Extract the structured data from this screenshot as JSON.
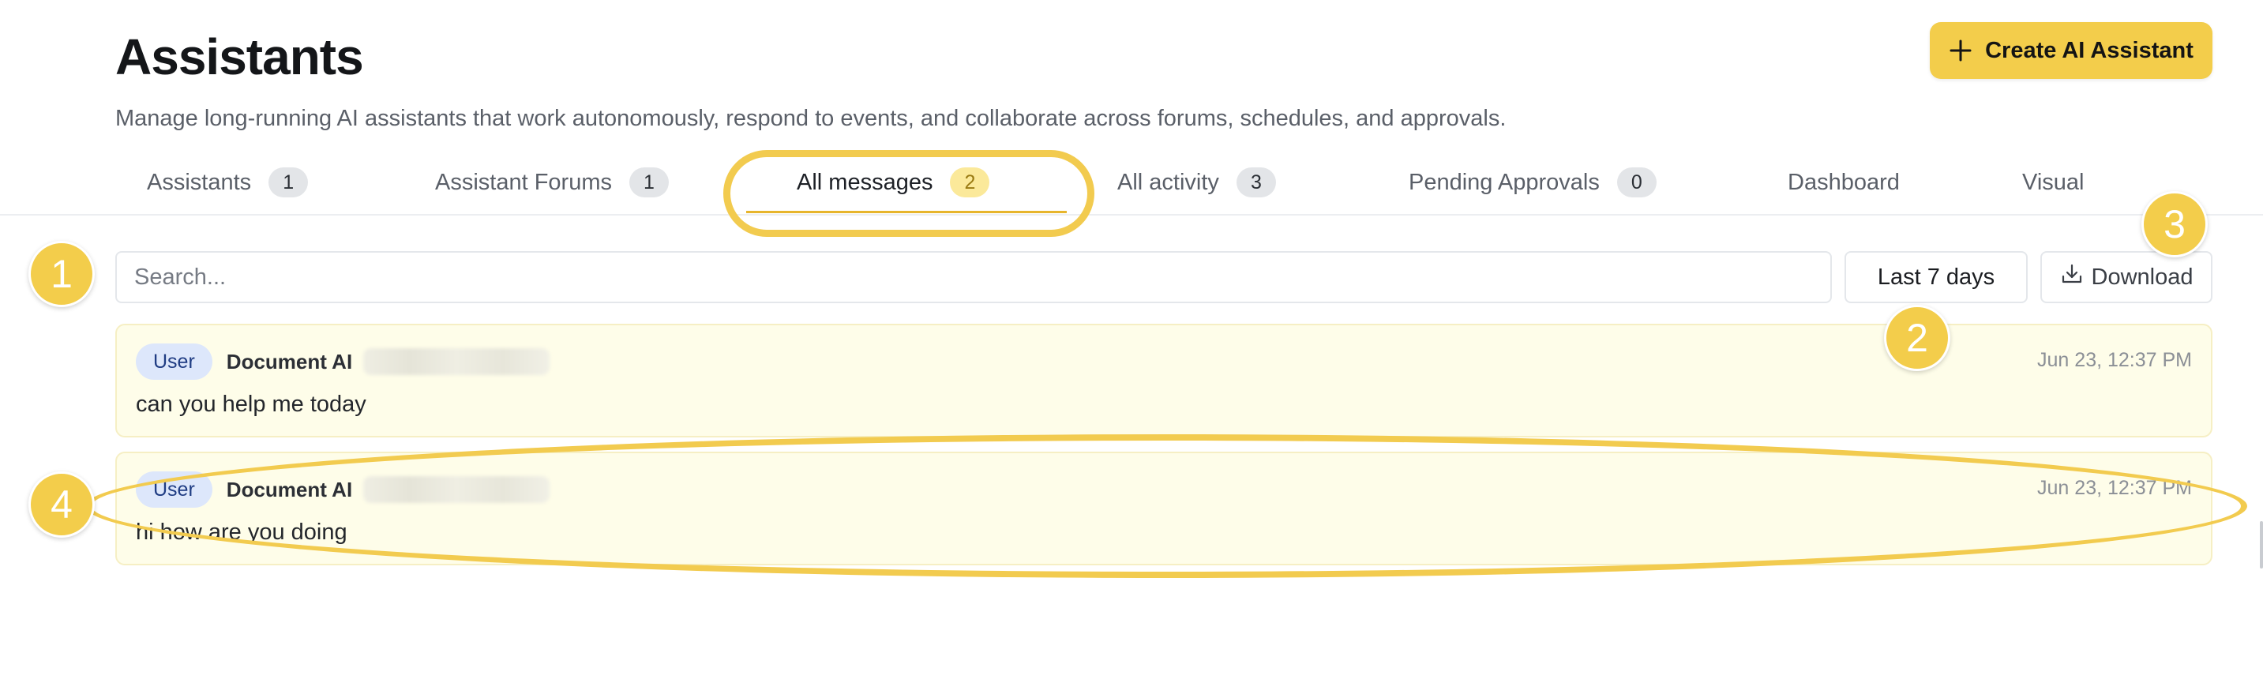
{
  "header": {
    "title": "Assistants",
    "subtitle": "Manage long-running AI assistants that work autonomously, respond to events, and collaborate across forums, schedules, and approvals.",
    "create_button": {
      "label": "Create AI Assistant",
      "icon": "plus-icon"
    }
  },
  "tabs": [
    {
      "label": "Assistants",
      "count": "1",
      "active": false
    },
    {
      "label": "Assistant Forums",
      "count": "1",
      "active": false
    },
    {
      "label": "All messages",
      "count": "2",
      "active": true
    },
    {
      "label": "All activity",
      "count": "3",
      "active": false
    },
    {
      "label": "Pending Approvals",
      "count": "0",
      "active": false
    },
    {
      "label": "Dashboard",
      "active": false
    },
    {
      "label": "Visual",
      "active": false
    }
  ],
  "toolbar": {
    "search_placeholder": "Search...",
    "date_range": "Last 7 days",
    "download_label": "Download",
    "download_icon": "download-tray-icon"
  },
  "messages": [
    {
      "role": "User",
      "assistant": "Document AI",
      "time": "Jun 23, 12:37 PM",
      "text": "can you help me today"
    },
    {
      "role": "User",
      "assistant": "Document AI",
      "time": "Jun 23, 12:37 PM",
      "text": "hi how are you doing"
    }
  ],
  "callouts": [
    "1",
    "2",
    "3",
    "4"
  ],
  "colors": {
    "accent": "#f3cd4b",
    "active_underline": "#e7b52c",
    "message_bg": "#fefde9",
    "role_badge_bg": "#dde7fb",
    "role_badge_text": "#1f3c83"
  }
}
